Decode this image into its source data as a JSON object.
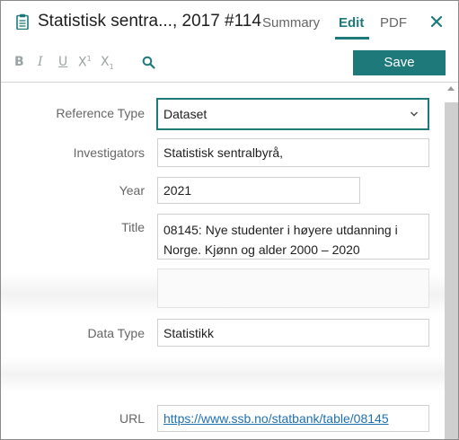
{
  "header": {
    "icon": "clipboard-icon",
    "title": "Statistisk sentra..., 2017 #114",
    "tabs": [
      {
        "label": "Summary",
        "active": false
      },
      {
        "label": "Edit",
        "active": true
      },
      {
        "label": "PDF",
        "active": false
      }
    ],
    "close_icon": "close-icon",
    "accent_color": "#1e7a7a"
  },
  "toolbar": {
    "bold": "B",
    "italic": "I",
    "underline": "U",
    "superscript": "X",
    "superscript_mark": "1",
    "subscript": "X",
    "subscript_mark": "1",
    "search_icon": "search-icon",
    "save_label": "Save"
  },
  "form": {
    "reference_type": {
      "label": "Reference Type",
      "value": "Dataset"
    },
    "investigators": {
      "label": "Investigators",
      "value": "Statistisk sentralbyrå,"
    },
    "year": {
      "label": "Year",
      "value": "2021"
    },
    "title": {
      "label": "Title",
      "value": "08145: Nye studenter i høyere utdanning i Norge. Kjønn og alder 2000 – 2020"
    },
    "data_type": {
      "label": "Data Type",
      "value": "Statistikk"
    },
    "url": {
      "label": "URL",
      "value": "https://www.ssb.no/statbank/table/08145"
    }
  }
}
